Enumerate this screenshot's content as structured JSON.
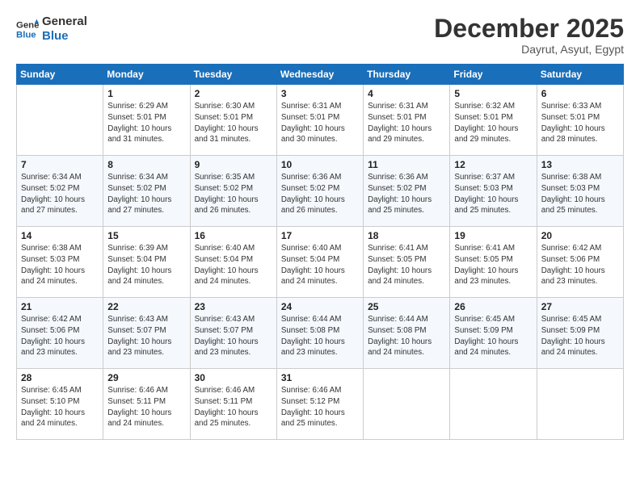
{
  "logo": {
    "line1": "General",
    "line2": "Blue"
  },
  "title": "December 2025",
  "subtitle": "Dayrut, Asyut, Egypt",
  "header_days": [
    "Sunday",
    "Monday",
    "Tuesday",
    "Wednesday",
    "Thursday",
    "Friday",
    "Saturday"
  ],
  "weeks": [
    [
      {
        "day": "",
        "info": ""
      },
      {
        "day": "1",
        "info": "Sunrise: 6:29 AM\nSunset: 5:01 PM\nDaylight: 10 hours\nand 31 minutes."
      },
      {
        "day": "2",
        "info": "Sunrise: 6:30 AM\nSunset: 5:01 PM\nDaylight: 10 hours\nand 31 minutes."
      },
      {
        "day": "3",
        "info": "Sunrise: 6:31 AM\nSunset: 5:01 PM\nDaylight: 10 hours\nand 30 minutes."
      },
      {
        "day": "4",
        "info": "Sunrise: 6:31 AM\nSunset: 5:01 PM\nDaylight: 10 hours\nand 29 minutes."
      },
      {
        "day": "5",
        "info": "Sunrise: 6:32 AM\nSunset: 5:01 PM\nDaylight: 10 hours\nand 29 minutes."
      },
      {
        "day": "6",
        "info": "Sunrise: 6:33 AM\nSunset: 5:01 PM\nDaylight: 10 hours\nand 28 minutes."
      }
    ],
    [
      {
        "day": "7",
        "info": "Sunrise: 6:34 AM\nSunset: 5:02 PM\nDaylight: 10 hours\nand 27 minutes."
      },
      {
        "day": "8",
        "info": "Sunrise: 6:34 AM\nSunset: 5:02 PM\nDaylight: 10 hours\nand 27 minutes."
      },
      {
        "day": "9",
        "info": "Sunrise: 6:35 AM\nSunset: 5:02 PM\nDaylight: 10 hours\nand 26 minutes."
      },
      {
        "day": "10",
        "info": "Sunrise: 6:36 AM\nSunset: 5:02 PM\nDaylight: 10 hours\nand 26 minutes."
      },
      {
        "day": "11",
        "info": "Sunrise: 6:36 AM\nSunset: 5:02 PM\nDaylight: 10 hours\nand 25 minutes."
      },
      {
        "day": "12",
        "info": "Sunrise: 6:37 AM\nSunset: 5:03 PM\nDaylight: 10 hours\nand 25 minutes."
      },
      {
        "day": "13",
        "info": "Sunrise: 6:38 AM\nSunset: 5:03 PM\nDaylight: 10 hours\nand 25 minutes."
      }
    ],
    [
      {
        "day": "14",
        "info": "Sunrise: 6:38 AM\nSunset: 5:03 PM\nDaylight: 10 hours\nand 24 minutes."
      },
      {
        "day": "15",
        "info": "Sunrise: 6:39 AM\nSunset: 5:04 PM\nDaylight: 10 hours\nand 24 minutes."
      },
      {
        "day": "16",
        "info": "Sunrise: 6:40 AM\nSunset: 5:04 PM\nDaylight: 10 hours\nand 24 minutes."
      },
      {
        "day": "17",
        "info": "Sunrise: 6:40 AM\nSunset: 5:04 PM\nDaylight: 10 hours\nand 24 minutes."
      },
      {
        "day": "18",
        "info": "Sunrise: 6:41 AM\nSunset: 5:05 PM\nDaylight: 10 hours\nand 24 minutes."
      },
      {
        "day": "19",
        "info": "Sunrise: 6:41 AM\nSunset: 5:05 PM\nDaylight: 10 hours\nand 23 minutes."
      },
      {
        "day": "20",
        "info": "Sunrise: 6:42 AM\nSunset: 5:06 PM\nDaylight: 10 hours\nand 23 minutes."
      }
    ],
    [
      {
        "day": "21",
        "info": "Sunrise: 6:42 AM\nSunset: 5:06 PM\nDaylight: 10 hours\nand 23 minutes."
      },
      {
        "day": "22",
        "info": "Sunrise: 6:43 AM\nSunset: 5:07 PM\nDaylight: 10 hours\nand 23 minutes."
      },
      {
        "day": "23",
        "info": "Sunrise: 6:43 AM\nSunset: 5:07 PM\nDaylight: 10 hours\nand 23 minutes."
      },
      {
        "day": "24",
        "info": "Sunrise: 6:44 AM\nSunset: 5:08 PM\nDaylight: 10 hours\nand 23 minutes."
      },
      {
        "day": "25",
        "info": "Sunrise: 6:44 AM\nSunset: 5:08 PM\nDaylight: 10 hours\nand 24 minutes."
      },
      {
        "day": "26",
        "info": "Sunrise: 6:45 AM\nSunset: 5:09 PM\nDaylight: 10 hours\nand 24 minutes."
      },
      {
        "day": "27",
        "info": "Sunrise: 6:45 AM\nSunset: 5:09 PM\nDaylight: 10 hours\nand 24 minutes."
      }
    ],
    [
      {
        "day": "28",
        "info": "Sunrise: 6:45 AM\nSunset: 5:10 PM\nDaylight: 10 hours\nand 24 minutes."
      },
      {
        "day": "29",
        "info": "Sunrise: 6:46 AM\nSunset: 5:11 PM\nDaylight: 10 hours\nand 24 minutes."
      },
      {
        "day": "30",
        "info": "Sunrise: 6:46 AM\nSunset: 5:11 PM\nDaylight: 10 hours\nand 25 minutes."
      },
      {
        "day": "31",
        "info": "Sunrise: 6:46 AM\nSunset: 5:12 PM\nDaylight: 10 hours\nand 25 minutes."
      },
      {
        "day": "",
        "info": ""
      },
      {
        "day": "",
        "info": ""
      },
      {
        "day": "",
        "info": ""
      }
    ]
  ]
}
